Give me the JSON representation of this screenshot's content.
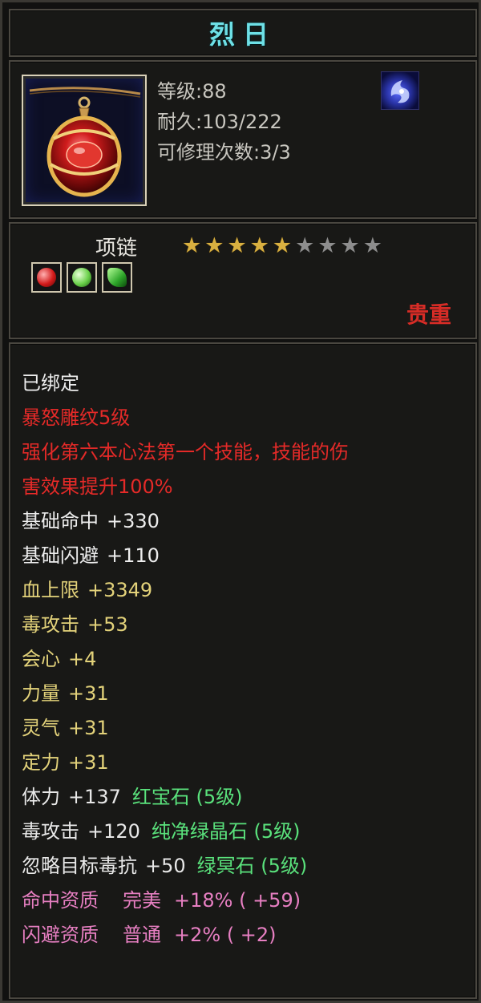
{
  "item": {
    "name": "烈日",
    "level_text": "等级:88",
    "durability_text": "耐久:103/222",
    "repair_text": "可修理次数:3/3",
    "category": "项链",
    "rarity": "贵重",
    "stars_total": 9,
    "stars_filled": 5,
    "gem_slots": [
      "ruby-gem-icon",
      "green-crystal-gem-icon",
      "green-jade-gem-icon"
    ]
  },
  "details": {
    "bound": "已绑定",
    "engrave_name": "暴怒雕纹5级",
    "engrave_desc_1": "强化第六本心法第一个技能，技能的伤",
    "engrave_desc_2": "害效果提升100%",
    "stats": [
      {
        "label": "基础命中",
        "value": "+330"
      },
      {
        "label": "基础闪避",
        "value": "+110"
      },
      {
        "label": "血上限",
        "value": "+3349"
      },
      {
        "label": "毒攻击",
        "value": "+53"
      },
      {
        "label": "会心",
        "value": "+4"
      },
      {
        "label": "力量",
        "value": "+31"
      },
      {
        "label": "灵气",
        "value": "+31"
      },
      {
        "label": "定力",
        "value": "+31"
      }
    ],
    "gem_stats": [
      {
        "label": "体力",
        "value": "+137",
        "gem": "红宝石 (5级)"
      },
      {
        "label": "毒攻击",
        "value": "+120",
        "gem": "纯净绿晶石 (5级)"
      },
      {
        "label": "忽略目标毒抗",
        "value": "+50",
        "gem": "绿冥石 (5级)"
      }
    ],
    "qualities": [
      {
        "label": "命中资质",
        "grade": "完美",
        "value": "+18% ( +59)"
      },
      {
        "label": "闪避资质",
        "grade": "普通",
        "value": "+2% ( +2)"
      }
    ]
  },
  "colors": {
    "title": "#6ee0e6",
    "rarity": "#d62c26",
    "engrave": "#e42a28",
    "base_stat": "#ededed",
    "attr_stat": "#e3d27a",
    "gem_stat": "#5ae27c",
    "quality": "#e77fc2"
  }
}
